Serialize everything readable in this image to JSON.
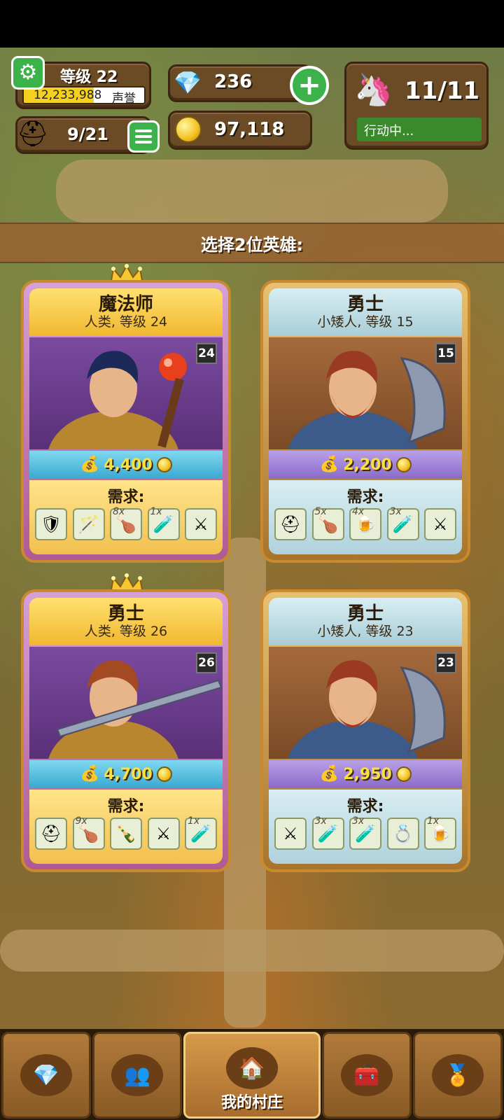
{
  "hud": {
    "level_label": "等级 22",
    "prestige_value": "12,233,988",
    "prestige_label": "声誉",
    "prestige_fill_pct": 58,
    "gems": "236",
    "gold": "97,118",
    "heroes": "9/21",
    "energy": "11/11",
    "energy_status": "行动中..."
  },
  "banner": {
    "text": "选择2位英雄:"
  },
  "cards": [
    {
      "title": "魔法师",
      "subtitle": "人类, 等级 24",
      "level": "24",
      "price": "4,400",
      "crown": true,
      "req_label": "需求:",
      "items": [
        {
          "icon": "armor-icon",
          "glyph": "🛡",
          "qty": ""
        },
        {
          "icon": "staff-icon",
          "glyph": "🪄",
          "qty": ""
        },
        {
          "icon": "meat-icon",
          "glyph": "🍗",
          "qty": "8x"
        },
        {
          "icon": "potion-icon",
          "glyph": "🧪",
          "qty": "1x"
        },
        {
          "icon": "swords-icon",
          "glyph": "⚔",
          "qty": ""
        }
      ]
    },
    {
      "title": "勇士",
      "subtitle": "小矮人, 等级 15",
      "level": "15",
      "price": "2,200",
      "crown": false,
      "req_label": "需求:",
      "items": [
        {
          "icon": "helmet-icon",
          "glyph": "⛑",
          "qty": ""
        },
        {
          "icon": "meat-icon",
          "glyph": "🍗",
          "qty": "5x"
        },
        {
          "icon": "beer-icon",
          "glyph": "🍺",
          "qty": "4x"
        },
        {
          "icon": "potion-icon",
          "glyph": "🧪",
          "qty": "3x"
        },
        {
          "icon": "swords-icon",
          "glyph": "⚔",
          "qty": ""
        }
      ]
    },
    {
      "title": "勇士",
      "subtitle": "人类, 等级 26",
      "level": "26",
      "price": "4,700",
      "crown": true,
      "req_label": "需求:",
      "items": [
        {
          "icon": "helmet-icon",
          "glyph": "⛑",
          "qty": ""
        },
        {
          "icon": "meat-icon",
          "glyph": "🍗",
          "qty": "9x"
        },
        {
          "icon": "bottle-icon",
          "glyph": "🍾",
          "qty": ""
        },
        {
          "icon": "swords-icon",
          "glyph": "⚔",
          "qty": ""
        },
        {
          "icon": "potion-icon",
          "glyph": "🧪",
          "qty": "1x"
        }
      ]
    },
    {
      "title": "勇士",
      "subtitle": "小矮人, 等级 23",
      "level": "23",
      "price": "2,950",
      "crown": false,
      "req_label": "需求:",
      "items": [
        {
          "icon": "swords-icon",
          "glyph": "⚔",
          "qty": ""
        },
        {
          "icon": "potion-icon",
          "glyph": "🧪",
          "qty": "3x"
        },
        {
          "icon": "potion-icon",
          "glyph": "🧪",
          "qty": "3x"
        },
        {
          "icon": "ring-icon",
          "glyph": "💍",
          "qty": ""
        },
        {
          "icon": "beer-icon",
          "glyph": "🍺",
          "qty": "1x"
        }
      ]
    }
  ],
  "nav": [
    {
      "icon": "gem-icon",
      "glyph": "💎",
      "label": ""
    },
    {
      "icon": "heroes-icon",
      "glyph": "👥",
      "label": ""
    },
    {
      "icon": "village-icon",
      "glyph": "🏠",
      "label": "我的村庄"
    },
    {
      "icon": "chest-icon",
      "glyph": "🧰",
      "label": ""
    },
    {
      "icon": "medal-icon",
      "glyph": "🏅",
      "label": ""
    }
  ],
  "colors": {
    "accent_green": "#3bb34a",
    "gold": "#f2c020",
    "panel_brown": "#6b4a26"
  }
}
